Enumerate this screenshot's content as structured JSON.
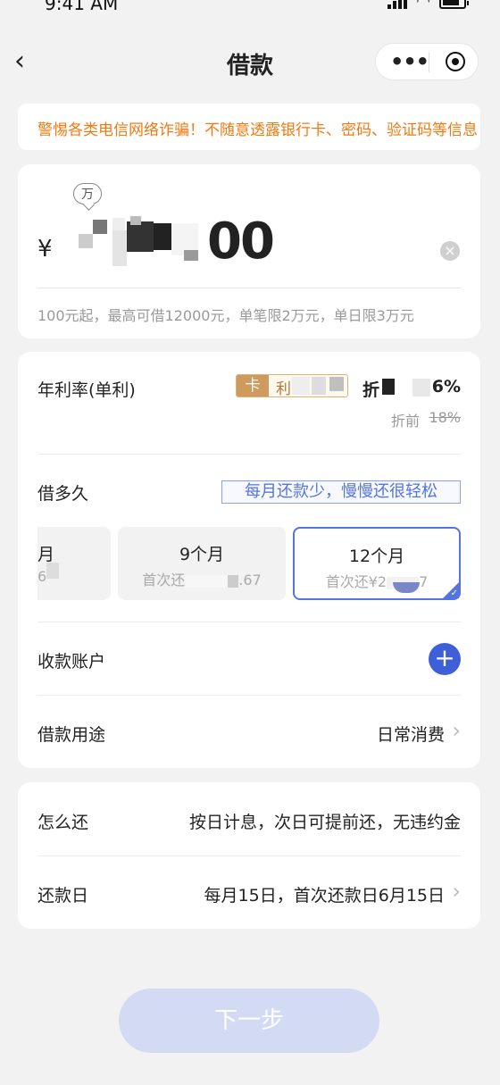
{
  "status_bar": {
    "time": "9:41 AM"
  },
  "nav": {
    "title": "借款",
    "back_icon": "chevron-left-icon",
    "more_icon": "more-dots-icon",
    "close_icon": "target-circle-icon"
  },
  "notice": {
    "text": "警惕各类电信网络诈骗！不随意透露银行卡、密码、验证码等信息"
  },
  "amount": {
    "unit_badge": "万",
    "currency": "¥",
    "value": "00",
    "hint": "100元起，最高可借12000元，单笔限2万元，单日限3万元"
  },
  "rate": {
    "label": "年利率(单利)",
    "tag_card": "卡",
    "tag_text": "利",
    "discount_label": "折",
    "value": "6%",
    "before_label": "折前",
    "before_value": "18%"
  },
  "term": {
    "label": "借多久",
    "tip": "每月还款少，慢慢还很轻松",
    "options": [
      {
        "title": "月",
        "sub": "6",
        "selected": false
      },
      {
        "title": "9个月",
        "sub_prefix": "首次还",
        "sub_suffix": ".67",
        "selected": false
      },
      {
        "title": "12个月",
        "sub_prefix": "首次还¥2",
        "sub_suffix": "7",
        "selected": true
      }
    ]
  },
  "account": {
    "label": "收款账户",
    "add_icon": "plus-icon"
  },
  "purpose": {
    "label": "借款用途",
    "value": "日常消费"
  },
  "repay": {
    "how_label": "怎么还",
    "how_value": "按日计息，次日可提前还，无违约金",
    "day_label": "还款日",
    "day_value": "每月15日，首次还款日6月15日"
  },
  "next_button": "下一步",
  "colors": {
    "accent": "#5574e0",
    "warning": "#f07a12",
    "tag_gold": "#cf9a5e",
    "button_disabled": "#d3dbf4"
  }
}
